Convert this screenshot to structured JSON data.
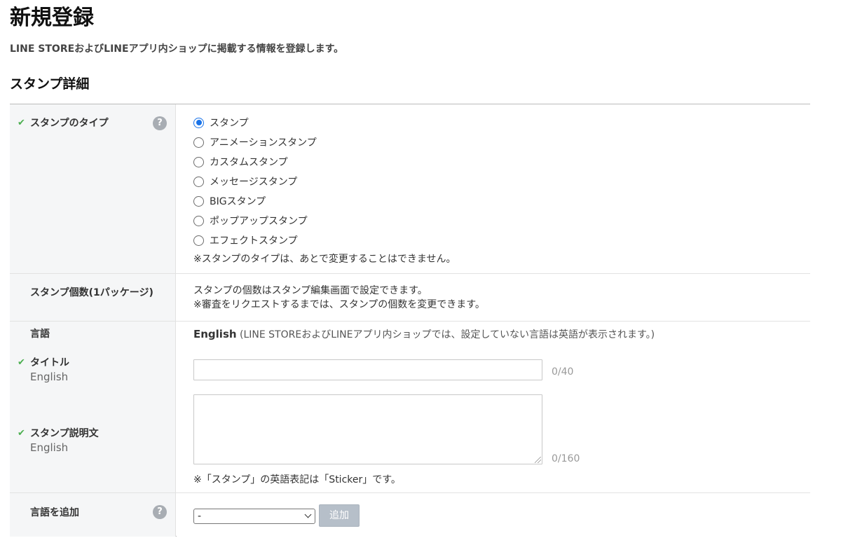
{
  "page": {
    "title": "新規登録",
    "subtitle": "LINE STOREおよびLINEアプリ内ショップに掲載する情報を登録します。"
  },
  "section": {
    "title": "スタンプ詳細"
  },
  "sticker_type": {
    "label": "スタンプのタイプ",
    "help_icon": "?",
    "options": [
      {
        "label": "スタンプ",
        "checked": true
      },
      {
        "label": "アニメーションスタンプ",
        "checked": false
      },
      {
        "label": "カスタムスタンプ",
        "checked": false
      },
      {
        "label": "メッセージスタンプ",
        "checked": false
      },
      {
        "label": "BIGスタンプ",
        "checked": false
      },
      {
        "label": "ポップアップスタンプ",
        "checked": false
      },
      {
        "label": "エフェクトスタンプ",
        "checked": false
      }
    ],
    "note": "※スタンプのタイプは、あとで変更することはできません。"
  },
  "sticker_count": {
    "label": "スタンプ個数(1パッケージ)",
    "line1": "スタンプの個数はスタンプ編集画面で設定できます。",
    "line2": "※審査をリクエストするまでは、スタンプの個数を変更できます。"
  },
  "language": {
    "label": "言語",
    "current": "English",
    "note": "(LINE STOREおよびLINEアプリ内ショップでは、設定していない言語は英語が表示されます。)",
    "title_label": "タイトル",
    "title_sublabel": "English",
    "title_value": "",
    "title_counter": "0/40",
    "desc_label": "スタンプ説明文",
    "desc_sublabel": "English",
    "desc_value": "",
    "desc_counter": "0/160",
    "footnote": "※「スタンプ」の英語表記は「Sticker」です。"
  },
  "add_language": {
    "label": "言語を追加",
    "help_icon": "?",
    "select_value": "-",
    "button_label": "追加"
  },
  "colors": {
    "check": "#4caf50",
    "radio_selected": "#1a73e8",
    "button_disabled": "#b6bfc9",
    "label_bg": "#f5f6f7"
  }
}
